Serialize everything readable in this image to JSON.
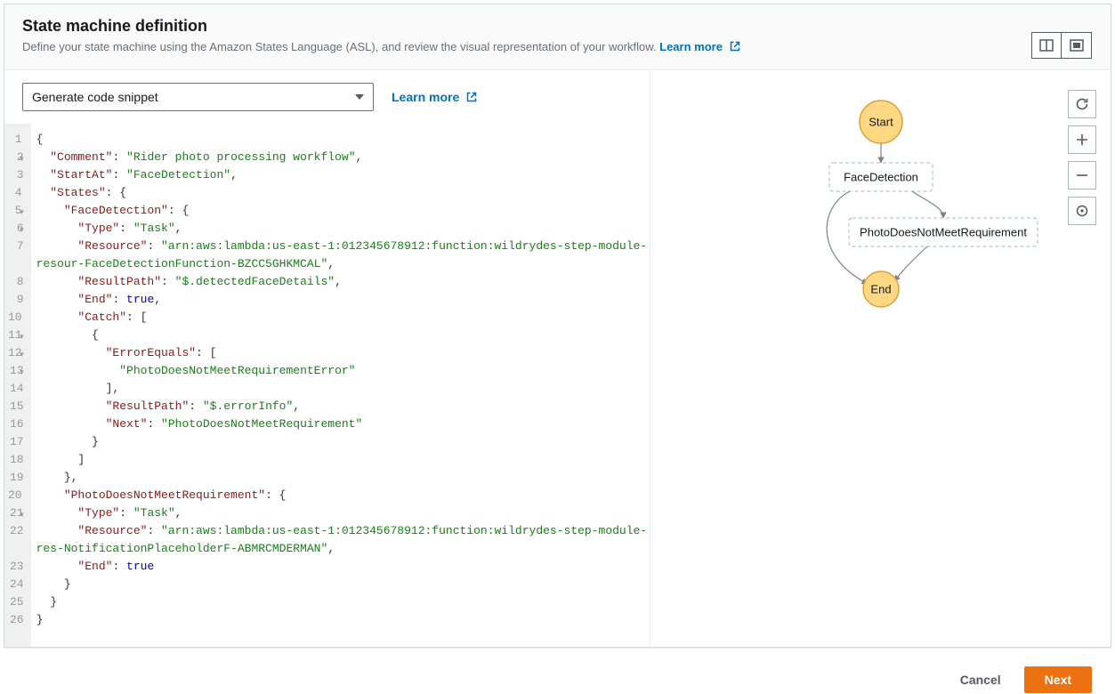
{
  "header": {
    "title": "State machine definition",
    "subtitle_pre": "Define your state machine using the Amazon States Language (ASL), and review the visual representation of your workflow. ",
    "learn_more": "Learn more"
  },
  "code_toolbar": {
    "dropdown_label": "Generate code snippet",
    "learn_more": "Learn more"
  },
  "graph": {
    "start": "Start",
    "face_detection": "FaceDetection",
    "not_meet": "PhotoDoesNotMeetRequirement",
    "end": "End"
  },
  "footer": {
    "cancel": "Cancel",
    "next": "Next"
  },
  "code_lines": [
    {
      "n": "1",
      "fold": true,
      "tokens": [
        [
          "p",
          "{"
        ]
      ]
    },
    {
      "n": "2",
      "fold": false,
      "tokens": [
        [
          "p",
          "  "
        ],
        [
          "k",
          "\"Comment\""
        ],
        [
          "p",
          ": "
        ],
        [
          "s",
          "\"Rider photo processing workflow\""
        ],
        [
          "p",
          ","
        ]
      ]
    },
    {
      "n": "3",
      "fold": false,
      "tokens": [
        [
          "p",
          "  "
        ],
        [
          "k",
          "\"StartAt\""
        ],
        [
          "p",
          ": "
        ],
        [
          "s",
          "\"FaceDetection\""
        ],
        [
          "p",
          ","
        ]
      ]
    },
    {
      "n": "4",
      "fold": true,
      "tokens": [
        [
          "p",
          "  "
        ],
        [
          "k",
          "\"States\""
        ],
        [
          "p",
          ": {"
        ]
      ]
    },
    {
      "n": "5",
      "fold": true,
      "tokens": [
        [
          "p",
          "    "
        ],
        [
          "k",
          "\"FaceDetection\""
        ],
        [
          "p",
          ": {"
        ]
      ]
    },
    {
      "n": "6",
      "fold": false,
      "tokens": [
        [
          "p",
          "      "
        ],
        [
          "k",
          "\"Type\""
        ],
        [
          "p",
          ": "
        ],
        [
          "s",
          "\"Task\""
        ],
        [
          "p",
          ","
        ]
      ]
    },
    {
      "n": "7",
      "fold": false,
      "tokens": [
        [
          "p",
          "      "
        ],
        [
          "k",
          "\"Resource\""
        ],
        [
          "p",
          ": "
        ],
        [
          "s",
          "\"arn:aws:lambda:us-east-1:012345678912:function:wildrydes-step-module-"
        ]
      ]
    },
    {
      "n": "",
      "fold": false,
      "wrap": true,
      "tokens": [
        [
          "s",
          "resour-FaceDetectionFunction-BZCC5GHKMCAL\""
        ],
        [
          "p",
          ","
        ]
      ]
    },
    {
      "n": "8",
      "fold": false,
      "tokens": [
        [
          "p",
          "      "
        ],
        [
          "k",
          "\"ResultPath\""
        ],
        [
          "p",
          ": "
        ],
        [
          "s",
          "\"$.detectedFaceDetails\""
        ],
        [
          "p",
          ","
        ]
      ]
    },
    {
      "n": "9",
      "fold": false,
      "tokens": [
        [
          "p",
          "      "
        ],
        [
          "k",
          "\"End\""
        ],
        [
          "p",
          ": "
        ],
        [
          "n",
          "true"
        ],
        [
          "p",
          ","
        ]
      ]
    },
    {
      "n": "10",
      "fold": true,
      "tokens": [
        [
          "p",
          "      "
        ],
        [
          "k",
          "\"Catch\""
        ],
        [
          "p",
          ": ["
        ]
      ]
    },
    {
      "n": "11",
      "fold": true,
      "tokens": [
        [
          "p",
          "        {"
        ]
      ]
    },
    {
      "n": "12",
      "fold": true,
      "tokens": [
        [
          "p",
          "          "
        ],
        [
          "k",
          "\"ErrorEquals\""
        ],
        [
          "p",
          ": ["
        ]
      ]
    },
    {
      "n": "13",
      "fold": false,
      "tokens": [
        [
          "p",
          "            "
        ],
        [
          "s",
          "\"PhotoDoesNotMeetRequirementError\""
        ]
      ]
    },
    {
      "n": "14",
      "fold": false,
      "tokens": [
        [
          "p",
          "          ],"
        ]
      ]
    },
    {
      "n": "15",
      "fold": false,
      "tokens": [
        [
          "p",
          "          "
        ],
        [
          "k",
          "\"ResultPath\""
        ],
        [
          "p",
          ": "
        ],
        [
          "s",
          "\"$.errorInfo\""
        ],
        [
          "p",
          ","
        ]
      ]
    },
    {
      "n": "16",
      "fold": false,
      "tokens": [
        [
          "p",
          "          "
        ],
        [
          "k",
          "\"Next\""
        ],
        [
          "p",
          ": "
        ],
        [
          "s",
          "\"PhotoDoesNotMeetRequirement\""
        ]
      ]
    },
    {
      "n": "17",
      "fold": false,
      "tokens": [
        [
          "p",
          "        }"
        ]
      ]
    },
    {
      "n": "18",
      "fold": false,
      "tokens": [
        [
          "p",
          "      ]"
        ]
      ]
    },
    {
      "n": "19",
      "fold": false,
      "tokens": [
        [
          "p",
          "    },"
        ]
      ]
    },
    {
      "n": "20",
      "fold": true,
      "tokens": [
        [
          "p",
          "    "
        ],
        [
          "k",
          "\"PhotoDoesNotMeetRequirement\""
        ],
        [
          "p",
          ": {"
        ]
      ]
    },
    {
      "n": "21",
      "fold": false,
      "tokens": [
        [
          "p",
          "      "
        ],
        [
          "k",
          "\"Type\""
        ],
        [
          "p",
          ": "
        ],
        [
          "s",
          "\"Task\""
        ],
        [
          "p",
          ","
        ]
      ]
    },
    {
      "n": "22",
      "fold": false,
      "tokens": [
        [
          "p",
          "      "
        ],
        [
          "k",
          "\"Resource\""
        ],
        [
          "p",
          ": "
        ],
        [
          "s",
          "\"arn:aws:lambda:us-east-1:012345678912:function:wildrydes-step-module-"
        ]
      ]
    },
    {
      "n": "",
      "fold": false,
      "wrap": true,
      "tokens": [
        [
          "s",
          "res-NotificationPlaceholderF-ABMRCMDERMAN\""
        ],
        [
          "p",
          ","
        ]
      ]
    },
    {
      "n": "23",
      "fold": false,
      "tokens": [
        [
          "p",
          "      "
        ],
        [
          "k",
          "\"End\""
        ],
        [
          "p",
          ": "
        ],
        [
          "n",
          "true"
        ]
      ]
    },
    {
      "n": "24",
      "fold": false,
      "tokens": [
        [
          "p",
          "    }"
        ]
      ]
    },
    {
      "n": "25",
      "fold": false,
      "tokens": [
        [
          "p",
          "  }"
        ]
      ]
    },
    {
      "n": "26",
      "fold": false,
      "tokens": [
        [
          "p",
          "}"
        ]
      ]
    }
  ]
}
